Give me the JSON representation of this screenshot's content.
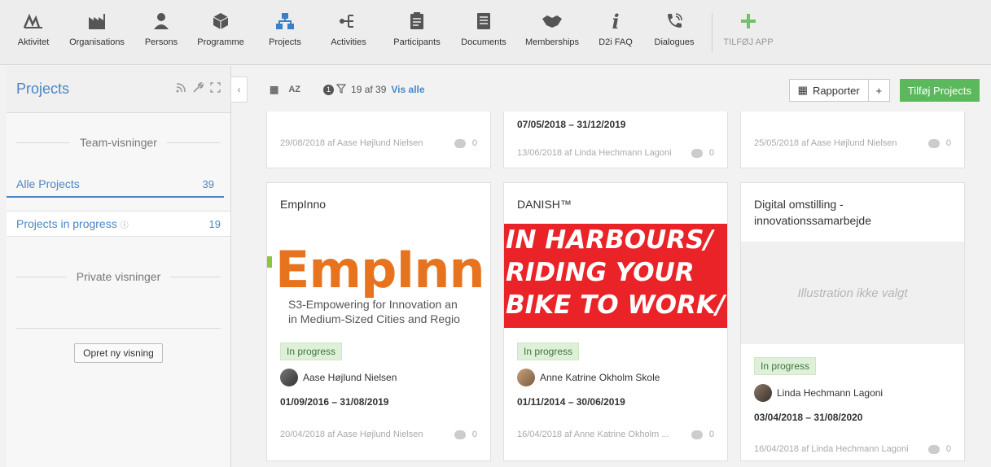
{
  "apps": [
    {
      "label": "Aktivitet",
      "icon": "activity-icon"
    },
    {
      "label": "Organisations",
      "icon": "factory-icon"
    },
    {
      "label": "Persons",
      "icon": "person-icon"
    },
    {
      "label": "Programme",
      "icon": "cube-icon"
    },
    {
      "label": "Projects",
      "icon": "hierarchy-icon"
    },
    {
      "label": "Activities",
      "icon": "flow-icon"
    },
    {
      "label": "Participants",
      "icon": "clipboard-icon"
    },
    {
      "label": "Documents",
      "icon": "document-icon"
    },
    {
      "label": "Memberships",
      "icon": "handshake-icon"
    },
    {
      "label": "D2i FAQ",
      "icon": "info-icon"
    },
    {
      "label": "Dialogues",
      "icon": "phone-icon"
    },
    {
      "label": "TILFØJ APP",
      "icon": "plus-icon"
    }
  ],
  "sidebar": {
    "title": "Projects",
    "team_label": "Team-visninger",
    "private_label": "Private visninger",
    "views": [
      {
        "label": "Alle Projects",
        "count": "39"
      },
      {
        "label": "Projects in progress",
        "count": "19"
      }
    ],
    "create_label": "Opret ny visning"
  },
  "toolbar": {
    "sort_label": "AZ",
    "filter_count": "1",
    "count_text": "19 af 39",
    "show_all": "Vis alle",
    "report_label": "Rapporter",
    "plus_label": "+",
    "add_label": "Tilføj Projects"
  },
  "cards_top": [
    {
      "meta": "29/08/2018 af Aase Højlund Nielsen",
      "comments": "0"
    },
    {
      "dates": "07/05/2018  –  31/12/2019",
      "meta": "13/06/2018 af Linda Hechmann Lagoni",
      "comments": "0"
    },
    {
      "meta": "25/05/2018 af Aase Højlund Nielsen",
      "comments": "0"
    }
  ],
  "cards": [
    {
      "title": "EmpInno",
      "image_logo": "EmpInn",
      "image_sub1": "S3-Empowering for Innovation an",
      "image_sub2": "in Medium-Sized Cities and Regio",
      "status": "In progress",
      "person": "Aase Højlund Nielsen",
      "dates": "01/09/2016  –  31/08/2019",
      "meta": "20/04/2018 af Aase Højlund Nielsen",
      "comments": "0"
    },
    {
      "title": "DANISH™",
      "image_line1": "IN HARBOURS/",
      "image_line2": "RIDING YOUR",
      "image_line3": "BIKE TO WORK/",
      "status": "In progress",
      "person": "Anne Katrine Okholm Skole",
      "dates": "01/11/2014  –  30/06/2019",
      "meta": "16/04/2018 af Anne Katrine Okholm ...",
      "comments": "0"
    },
    {
      "title": "Digital omstilling - innovationssamarbejde",
      "no_image": "Illustration ikke valgt",
      "status": "In progress",
      "person": "Linda Hechmann Lagoni",
      "dates": "03/04/2018  –  31/08/2020",
      "meta": "16/04/2018 af Linda Hechmann Lagoni",
      "comments": "0"
    }
  ],
  "colors": {
    "accent": "#4a86c5",
    "add_green": "#5cb85c",
    "status_bg": "#dff0d8"
  }
}
